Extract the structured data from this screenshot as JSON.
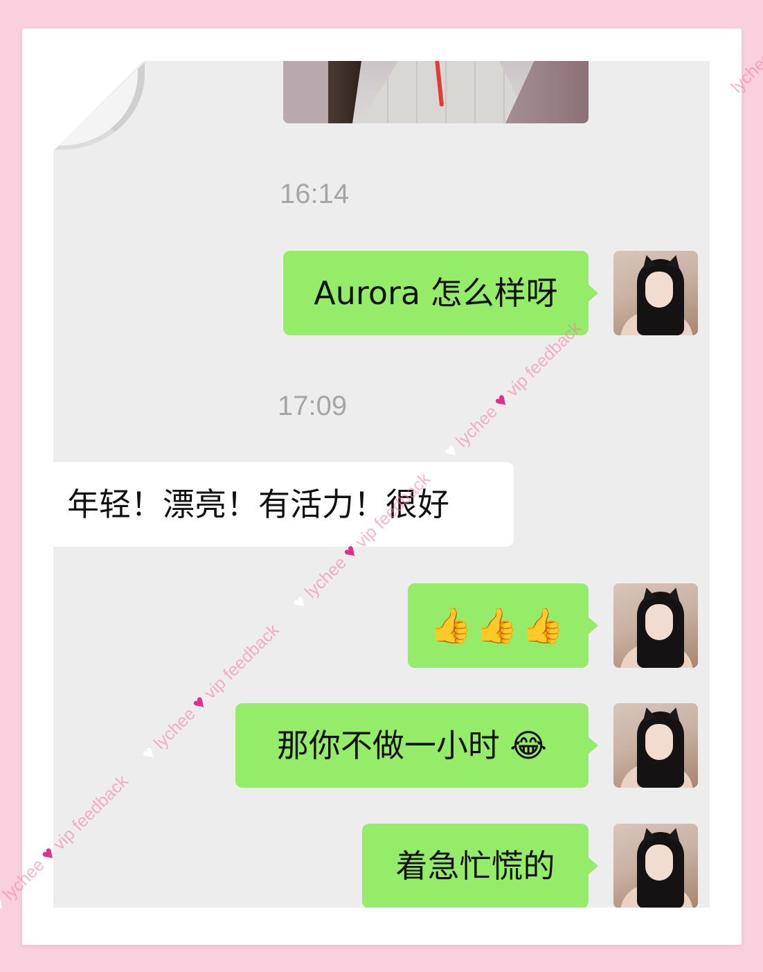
{
  "messages": {
    "time_1": "16:14",
    "msg_1": "Aurora 怎么样呀",
    "time_2": "17:09",
    "msg_2": "年轻！漂亮！有活力！很好",
    "msg_3": "👍👍👍",
    "msg_4": "那你不做一小时 😂",
    "msg_5": "着急忙慌的"
  },
  "watermark": {
    "part_a": "lychee",
    "part_b": "vip feedback",
    "corner": "lychee"
  },
  "colors": {
    "background": "#fbd0de",
    "chat_background": "#ededed",
    "my_bubble": "#95ec69",
    "other_bubble": "#ffffff"
  }
}
